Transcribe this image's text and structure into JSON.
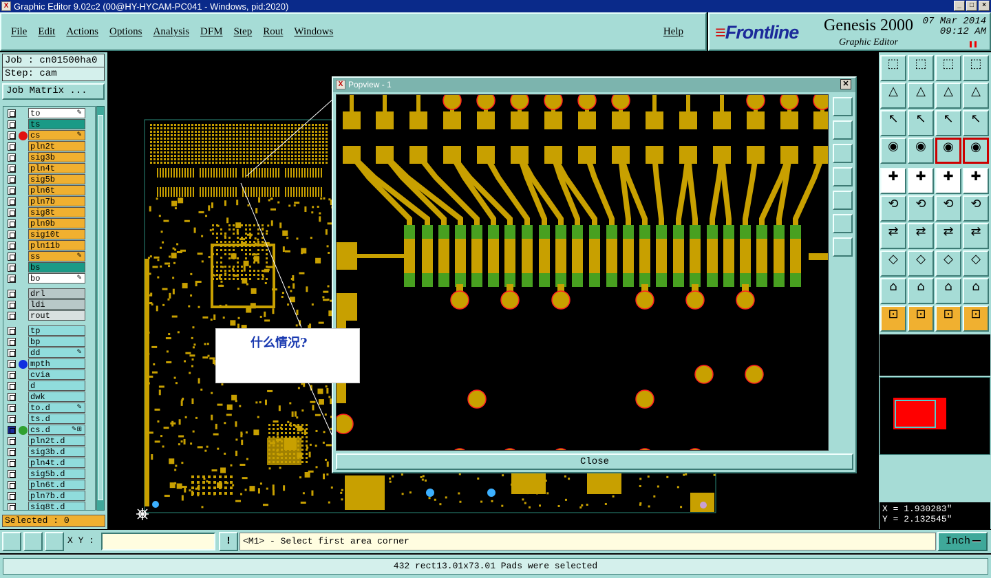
{
  "window": {
    "title": "Graphic Editor 9.02c2 (00@HY-HYCAM-PC041 - Windows, pid:2020)",
    "app_icon": "x-icon"
  },
  "menu": {
    "items": [
      "File",
      "Edit",
      "Actions",
      "Options",
      "Analysis",
      "DFM",
      "Step",
      "Rout",
      "Windows"
    ],
    "help": "Help"
  },
  "brand": {
    "logo": "Frontline",
    "product": "Genesis 2000",
    "subtitle": "Graphic Editor",
    "date": "07 Mar 2014",
    "time": "09:12 AM"
  },
  "job": {
    "job": "Job : cn01500ha0",
    "step": "Step: cam",
    "matrix_button": "Job Matrix ..."
  },
  "layers": [
    {
      "name": "to",
      "color": "#ffffff",
      "flag": "✎"
    },
    {
      "name": "ts",
      "color": "#1a9a86",
      "flag": ""
    },
    {
      "name": "cs",
      "color": "#f0b030",
      "flag": "✎",
      "dot": "#e01010"
    },
    {
      "name": "pln2t",
      "color": "#f0b030",
      "flag": ""
    },
    {
      "name": "sig3b",
      "color": "#f0b030",
      "flag": ""
    },
    {
      "name": "pln4t",
      "color": "#f0b030",
      "flag": ""
    },
    {
      "name": "sig5b",
      "color": "#f0b030",
      "flag": ""
    },
    {
      "name": "pln6t",
      "color": "#f0b030",
      "flag": ""
    },
    {
      "name": "pln7b",
      "color": "#f0b030",
      "flag": ""
    },
    {
      "name": "sig8t",
      "color": "#f0b030",
      "flag": ""
    },
    {
      "name": "pln9b",
      "color": "#f0b030",
      "flag": ""
    },
    {
      "name": "sig10t",
      "color": "#f0b030",
      "flag": ""
    },
    {
      "name": "pln11b",
      "color": "#f0b030",
      "flag": ""
    },
    {
      "name": "ss",
      "color": "#f0b030",
      "flag": "✎"
    },
    {
      "name": "bs",
      "color": "#1a9a86",
      "flag": ""
    },
    {
      "name": "bo",
      "color": "#ffffff",
      "flag": "✎"
    },
    {
      "name": "drl",
      "color": "#b8c8c8",
      "flag": "",
      "gap": true
    },
    {
      "name": "ldi",
      "color": "#b8c8c8",
      "flag": ""
    },
    {
      "name": "rout",
      "color": "#d8e0e0",
      "flag": ""
    },
    {
      "name": "tp",
      "color": "#90dcdc",
      "flag": "",
      "gap": true
    },
    {
      "name": "bp",
      "color": "#90dcdc",
      "flag": ""
    },
    {
      "name": "dd",
      "color": "#90dcdc",
      "flag": "✎"
    },
    {
      "name": "mpth",
      "color": "#90dcdc",
      "flag": "",
      "dot": "#1030e0"
    },
    {
      "name": "cvia",
      "color": "#90dcdc",
      "flag": ""
    },
    {
      "name": "d",
      "color": "#90dcdc",
      "flag": ""
    },
    {
      "name": "dwk",
      "color": "#90dcdc",
      "flag": ""
    },
    {
      "name": "to.d",
      "color": "#90dcdc",
      "flag": "✎"
    },
    {
      "name": "ts.d",
      "color": "#90dcdc",
      "flag": ""
    },
    {
      "name": "cs.d",
      "color": "#90dcdc",
      "flag": "✎⊞",
      "dot": "#30a030",
      "active": true
    },
    {
      "name": "pln2t.d",
      "color": "#90dcdc",
      "flag": ""
    },
    {
      "name": "sig3b.d",
      "color": "#90dcdc",
      "flag": ""
    },
    {
      "name": "pln4t.d",
      "color": "#90dcdc",
      "flag": ""
    },
    {
      "name": "sig5b.d",
      "color": "#90dcdc",
      "flag": ""
    },
    {
      "name": "pln6t.d",
      "color": "#90dcdc",
      "flag": ""
    },
    {
      "name": "pln7b.d",
      "color": "#90dcdc",
      "flag": ""
    },
    {
      "name": "sig8t.d",
      "color": "#90dcdc",
      "flag": ""
    }
  ],
  "selected": "Selected : 0",
  "popview": {
    "title": "Popview - 1",
    "close_button": "Close"
  },
  "annotation": {
    "text": "什么情况?"
  },
  "coords": {
    "x": "X = 1.930283\"",
    "y": "Y = 2.132545\""
  },
  "bottom": {
    "xy_label": "X Y :",
    "xy_value": "",
    "message": "<M1> - Select first area corner",
    "unit": "Inch"
  },
  "status": {
    "text": "432 rect13.01x73.01 Pads were selected"
  },
  "colors": {
    "copper": "#c8a000",
    "panel": "#a6dcd6",
    "pad_outline": "#ff2020",
    "solder_green": "#48a020"
  }
}
